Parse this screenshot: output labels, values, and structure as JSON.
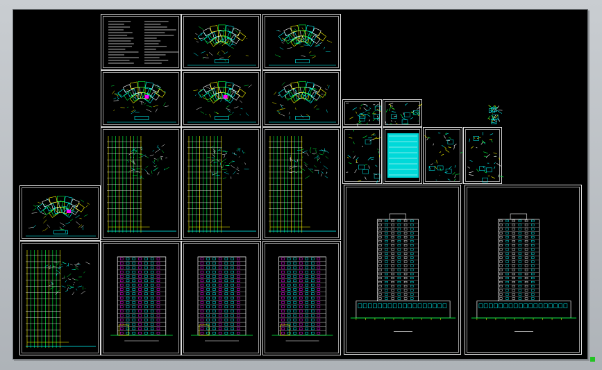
{
  "app": {
    "title": ""
  },
  "canvas": {
    "background": "#000000",
    "accent_cyan": "#00ffff",
    "accent_green": "#00ff40",
    "accent_magenta": "#ff00ff",
    "accent_yellow": "#ffff00",
    "sheet_border": "#e0e0e0"
  },
  "sheets": [
    {
      "id": "notes",
      "kind": "notes"
    },
    {
      "id": "plan-a",
      "kind": "plan"
    },
    {
      "id": "plan-b",
      "kind": "plan"
    },
    {
      "id": "plan-c",
      "kind": "plan"
    },
    {
      "id": "plan-d",
      "kind": "plan"
    },
    {
      "id": "plan-e",
      "kind": "plan"
    },
    {
      "id": "tall-plan-a",
      "kind": "tallplan"
    },
    {
      "id": "tall-plan-b",
      "kind": "tallplan"
    },
    {
      "id": "tall-plan-c",
      "kind": "tallplan"
    },
    {
      "id": "left-plan",
      "kind": "plan"
    },
    {
      "id": "left-tall-plan",
      "kind": "tallplan"
    },
    {
      "id": "elev-a",
      "kind": "elevation"
    },
    {
      "id": "elev-b",
      "kind": "elevation"
    },
    {
      "id": "elev-c",
      "kind": "elevation"
    },
    {
      "id": "detail-a",
      "kind": "detail"
    },
    {
      "id": "detail-b",
      "kind": "detail"
    },
    {
      "id": "detail-c",
      "kind": "detail"
    },
    {
      "id": "detail-d",
      "kind": "detail"
    },
    {
      "id": "detail-e",
      "kind": "detail"
    },
    {
      "id": "detail-f",
      "kind": "detail"
    },
    {
      "id": "tiny-detail",
      "kind": "detail"
    },
    {
      "id": "wide-elev-a",
      "kind": "wideelevation"
    },
    {
      "id": "wide-elev-b",
      "kind": "wideelevation"
    }
  ],
  "status": {
    "corner_indicator_color": "#22c322"
  }
}
